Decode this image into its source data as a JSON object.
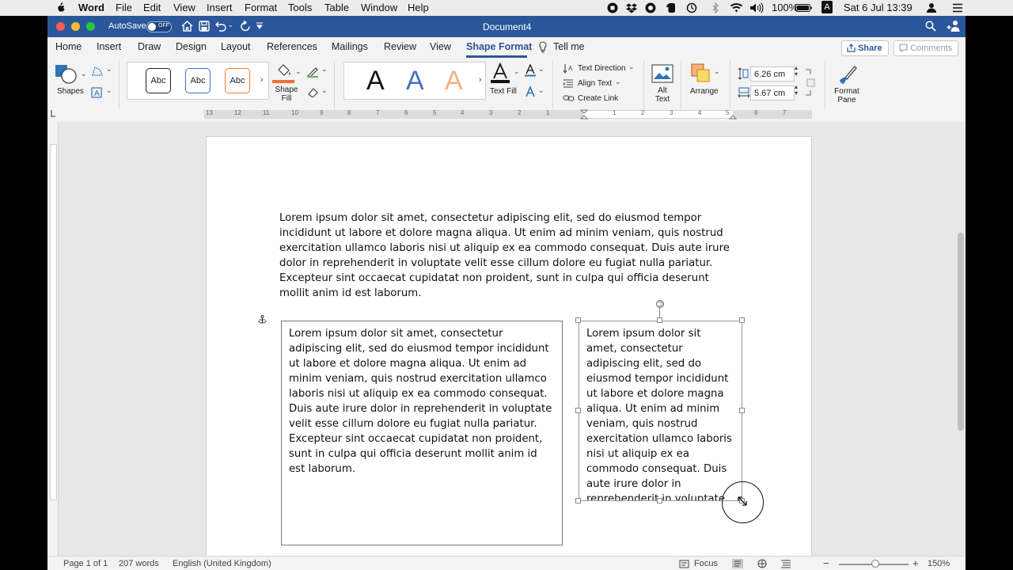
{
  "menubar": {
    "app_name": "Word",
    "menus": [
      "File",
      "Edit",
      "View",
      "Insert",
      "Format",
      "Tools",
      "Table",
      "Window",
      "Help"
    ],
    "battery": "100%",
    "datetime": "Sat 6 Jul  13:39",
    "input_source": "A"
  },
  "titlebar": {
    "autosave_label": "AutoSave",
    "autosave_state": "OFF",
    "document_title": "Document4"
  },
  "tabs": [
    "Home",
    "Insert",
    "Draw",
    "Design",
    "Layout",
    "References",
    "Mailings",
    "Review",
    "View",
    "Shape Format",
    "Tell me"
  ],
  "active_tab": "Shape Format",
  "share_label": "Share",
  "comments_label": "Comments",
  "ribbon": {
    "shapes_label": "Shapes",
    "style_samples": [
      "Abc",
      "Abc",
      "Abc"
    ],
    "shape_fill_label": "Shape Fill",
    "wordart_samples": [
      "A",
      "A",
      "A"
    ],
    "text_fill_label": "Text Fill",
    "text_direction_label": "Text Direction",
    "align_text_label": "Align Text",
    "create_link_label": "Create Link",
    "alt_text_label": "Alt Text",
    "arrange_label": "Arrange",
    "height_value": "6.26 cm",
    "width_value": "5.67 cm",
    "format_pane_label": "Format Pane"
  },
  "ruler_numbers": [
    "13",
    "12",
    "11",
    "10",
    "9",
    "8",
    "7",
    "6",
    "5",
    "4",
    "3",
    "2",
    "1",
    "1",
    "2",
    "3",
    "4",
    "5",
    "6",
    "7"
  ],
  "document": {
    "paragraph": "Lorem ipsum dolor sit amet, consectetur adipiscing elit, sed do eiusmod tempor incididunt ut labore et dolore magna aliqua. Ut enim ad minim veniam, quis nostrud exercitation ullamco laboris nisi ut aliquip ex ea commodo consequat. Duis aute irure dolor in reprehenderit in voluptate velit esse cillum dolore eu fugiat nulla pariatur. Excepteur sint occaecat cupidatat non proident, sunt in culpa qui officia deserunt mollit anim id est laborum.",
    "textbox1": "Lorem ipsum dolor sit amet, consectetur adipiscing elit, sed do eiusmod tempor incididunt ut labore et dolore magna aliqua. Ut enim ad minim veniam, quis nostrud exercitation ullamco laboris nisi ut aliquip ex ea commodo consequat. Duis aute irure dolor in reprehenderit in voluptate velit esse cillum dolore eu fugiat nulla pariatur. Excepteur sint occaecat cupidatat non proident, sunt in culpa qui officia deserunt mollit anim id est laborum.",
    "textbox2": "Lorem ipsum dolor sit amet, consectetur adipiscing elit, sed do eiusmod tempor incididunt ut labore et dolore magna aliqua. Ut enim ad minim veniam, quis nostrud exercitation ullamco laboris nisi ut aliquip ex ea commodo consequat. Duis aute irure dolor in reprehenderit in voluptate velit esse cillum dolore eu fugiat nulla"
  },
  "status": {
    "page": "Page 1 of 1",
    "words": "207 words",
    "language": "English (United Kingdom)",
    "focus": "Focus",
    "zoom_minus": "−",
    "zoom_plus": "+",
    "zoom": "150%"
  },
  "colors": {
    "accent": "#2b579a",
    "shape_fill_swatch": "#e97132",
    "wordart_blue": "#4472c4",
    "wordart_orange": "#f4b183"
  }
}
